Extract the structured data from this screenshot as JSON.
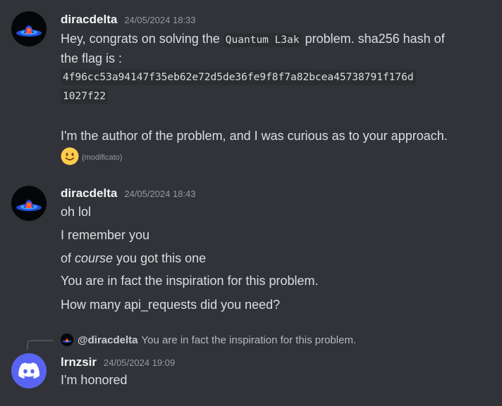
{
  "messages": [
    {
      "username": "diracdelta",
      "timestamp": "24/05/2024 18:33",
      "line1_before": "Hey, congrats on solving the ",
      "line1_code": "Quantum L3ak",
      "line1_after": " problem. sha256 hash of",
      "line2": "the flag is :",
      "hash_line1": "4f96cc53a94147f35eb62e72d5de36fe9f8f7a82bcea45738791f176d",
      "hash_line2": "1027f22",
      "line4": "I'm the author of the problem, and I was curious as to your approach.",
      "emoji": "slightly-smiling-face",
      "edited": "(modificato)"
    },
    {
      "username": "diracdelta",
      "timestamp": "24/05/2024 18:43",
      "lines": [
        "oh lol",
        "I remember you"
      ],
      "course_prefix": "of ",
      "course_em": "course",
      "course_suffix": " you got this one",
      "lines_after": [
        "You are in fact the inspiration for this problem.",
        "How many api_requests did you need?"
      ]
    },
    {
      "reply": {
        "user": "@diracdelta",
        "text": "You are in fact the inspiration for this problem."
      },
      "username": "lrnzsir",
      "timestamp": "24/05/2024 19:09",
      "text": "I'm honored"
    }
  ],
  "colors": {
    "background": "#313338",
    "username": "#f2f3f5",
    "timestamp": "#949ba4",
    "text": "#dbdee1",
    "discord_blurple": "#5865f2"
  }
}
